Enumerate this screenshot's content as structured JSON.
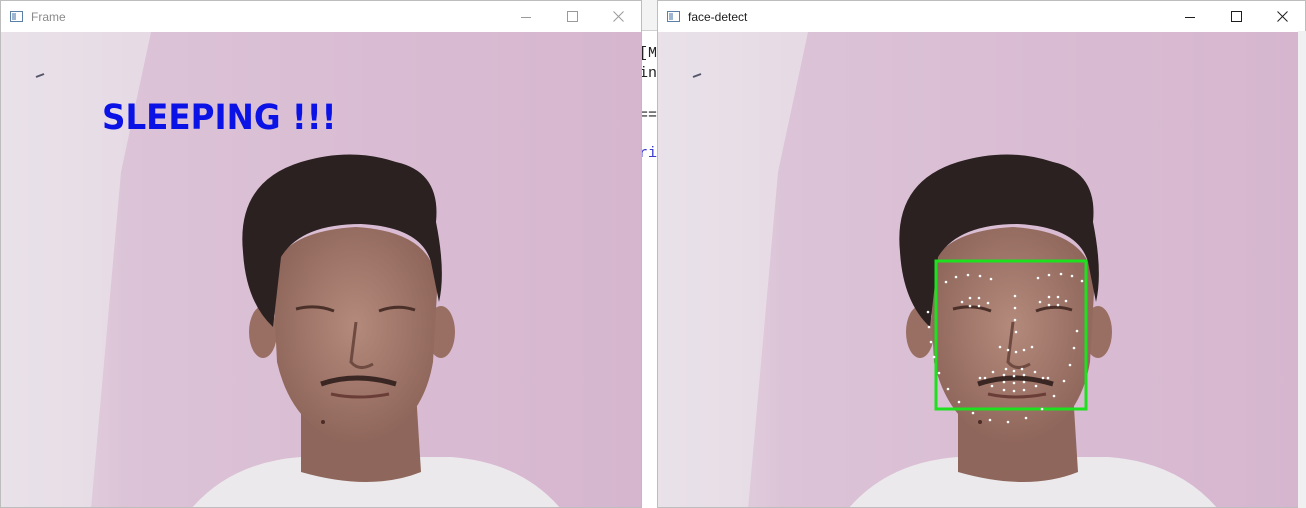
{
  "windows": {
    "frame": {
      "title": "Frame",
      "overlay_text": "SLEEPING !!!",
      "overlay_color": "#0a12e6"
    },
    "detect": {
      "title": "face-detect",
      "face_box_color": "#1ee01e",
      "landmark_color": "#ffffff"
    }
  },
  "console": {
    "lines": [
      "[M",
      "in",
      "==",
      "ri"
    ]
  },
  "icons": {
    "app": "window-app-icon",
    "minimize": "minimize-icon",
    "maximize": "maximize-icon",
    "close": "close-icon"
  }
}
